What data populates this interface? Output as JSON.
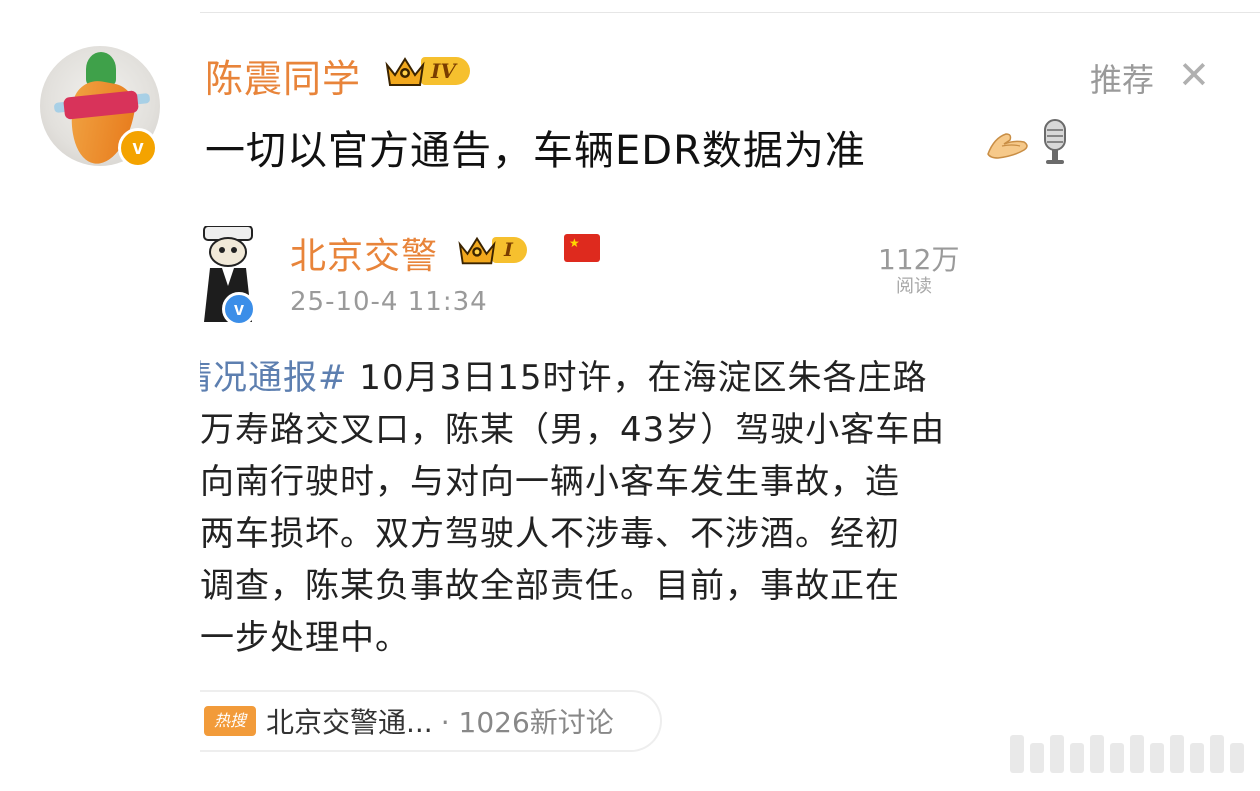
{
  "post": {
    "username": "陈震同学",
    "level": "IV",
    "recommend_label": "推荐",
    "close_glyph": "✕",
    "text": "一切以官方通告，车辆EDR数据为准",
    "verified_glyph": "v"
  },
  "embedded": {
    "username": "北京交警",
    "level": "I",
    "timestamp": "25-10-4 11:34",
    "reads_count": "112万",
    "reads_label": "阅读",
    "verified_glyph": "v",
    "body_lines": [
      {
        "tag": "情况通报#",
        "text": " 10月3日15时许，在海淀区朱各庄路"
      },
      {
        "tag": "",
        "text": "万寿路交叉口，陈某（男，43岁）驾驶小客车由"
      },
      {
        "tag": "",
        "text": "向南行驶时，与对向一辆小客车发生事故，造"
      },
      {
        "tag": "",
        "text": "两车损坏。双方驾驶人不涉毒、不涉酒。经初"
      },
      {
        "tag": "",
        "text": "调查，陈某负事故全部责任。目前，事故正在"
      },
      {
        "tag": "",
        "text": "一步处理中。"
      }
    ],
    "hot_icon": "热搜",
    "hot_topic": "北京交警通...",
    "hot_count": "· 1026新讨论"
  },
  "colors": {
    "username": "#e8843a",
    "verified_badge": "#f4a300",
    "blue_badge": "#3b8ee8",
    "hashtag": "#5d7fb0"
  }
}
